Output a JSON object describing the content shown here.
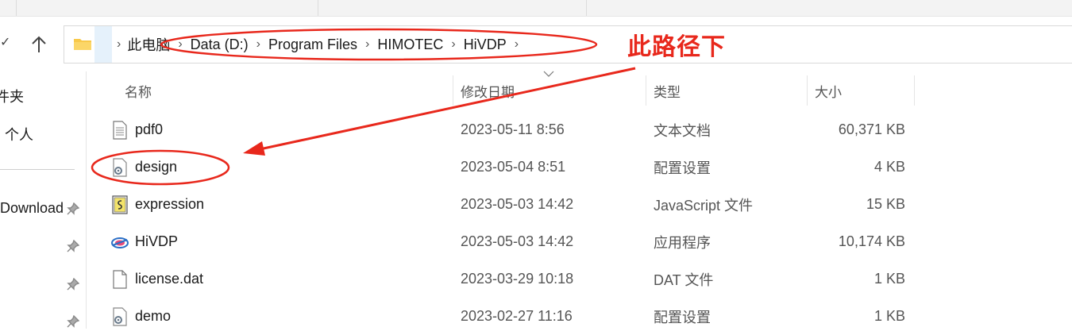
{
  "address": {
    "crumbs": [
      "此电脑",
      "Data (D:)",
      "Program Files",
      "HIMOTEC",
      "HiVDP"
    ]
  },
  "sidebar": {
    "items": [
      {
        "label": "件夹"
      },
      {
        "label": "个人"
      },
      {
        "label": "Download"
      }
    ]
  },
  "columns": {
    "name": "名称",
    "date": "修改日期",
    "type": "类型",
    "size": "大小"
  },
  "files": [
    {
      "name": "pdf0",
      "date": "2023-05-11 8:56",
      "type": "文本文档",
      "size": "60,371 KB",
      "icon": "text-file-icon"
    },
    {
      "name": "design",
      "date": "2023-05-04 8:51",
      "type": "配置设置",
      "size": "4 KB",
      "icon": "config-file-icon"
    },
    {
      "name": "expression",
      "date": "2023-05-03 14:42",
      "type": "JavaScript 文件",
      "size": "15 KB",
      "icon": "javascript-file-icon"
    },
    {
      "name": "HiVDP",
      "date": "2023-05-03 14:42",
      "type": "应用程序",
      "size": "10,174 KB",
      "icon": "app-icon"
    },
    {
      "name": "license.dat",
      "date": "2023-03-29 10:18",
      "type": "DAT 文件",
      "size": "1 KB",
      "icon": "blank-file-icon"
    },
    {
      "name": "demo",
      "date": "2023-02-27 11:16",
      "type": "配置设置",
      "size": "1 KB",
      "icon": "config-file-icon"
    }
  ],
  "annotation": {
    "text": "此路径下",
    "color": "#e8281c"
  },
  "colors": {
    "accent": "#e5f1fb",
    "folder": "#f8c94a"
  }
}
